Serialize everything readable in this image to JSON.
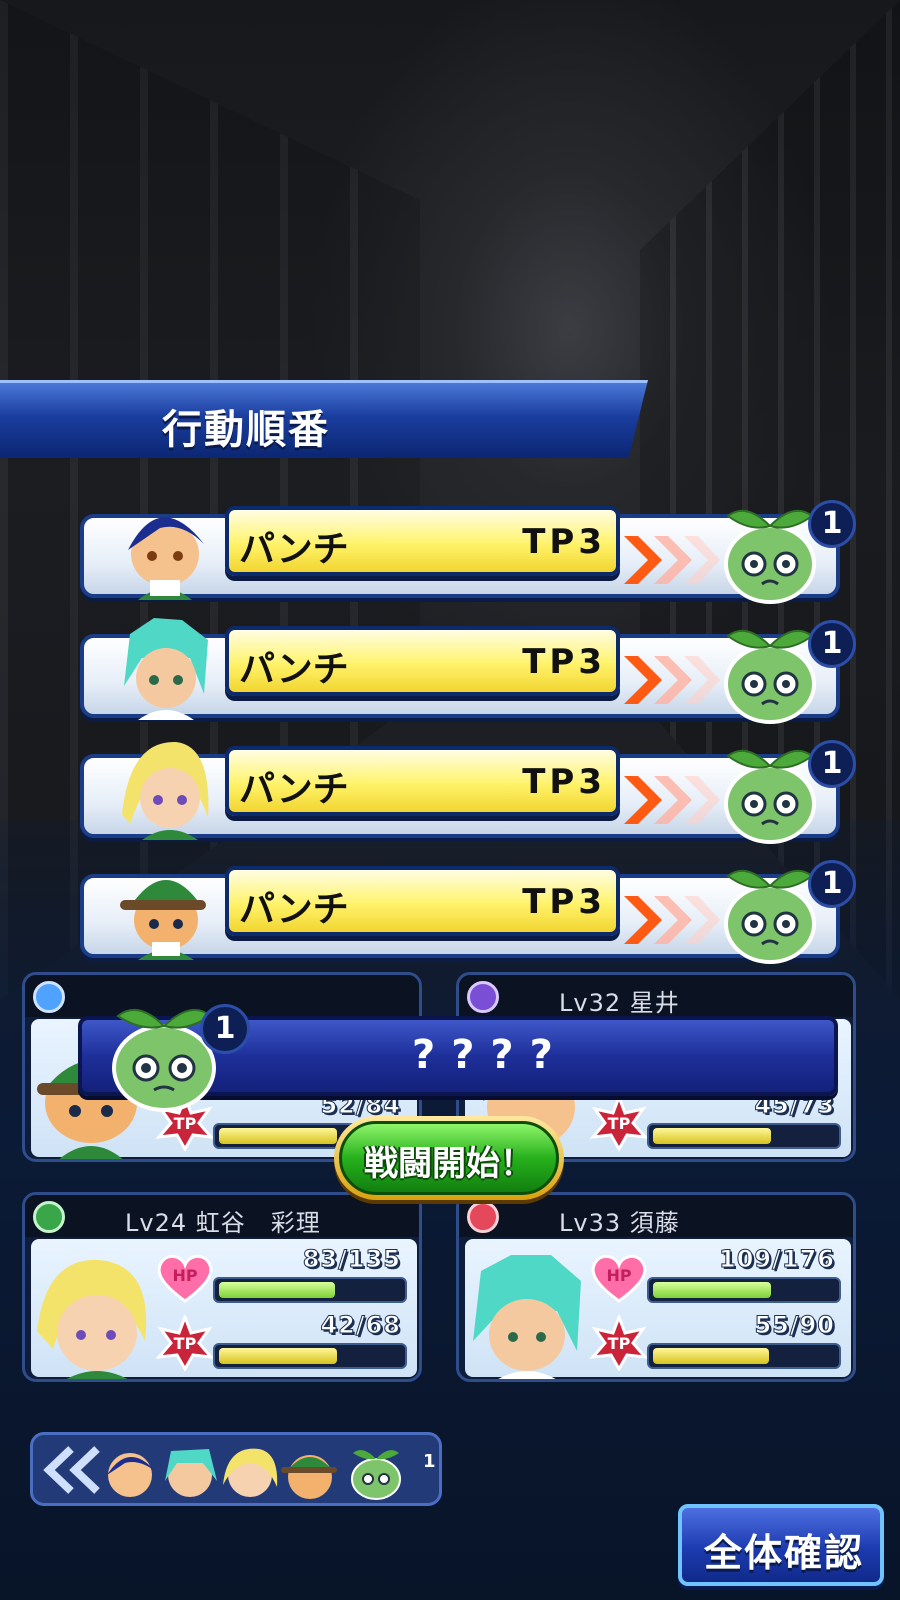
{
  "title": "行動順番",
  "actions": [
    {
      "skill": "パンチ",
      "tp": "TP3",
      "character": "blue-hair-boy",
      "target_number": "1"
    },
    {
      "skill": "パンチ",
      "tp": "TP3",
      "character": "teal-hair-boy",
      "target_number": "1"
    },
    {
      "skill": "パンチ",
      "tp": "TP3",
      "character": "blonde-girl",
      "target_number": "1"
    },
    {
      "skill": "パンチ",
      "tp": "TP3",
      "character": "green-cap-boy",
      "target_number": "1"
    }
  ],
  "enemy_action": {
    "skill": "????",
    "target_number": "1"
  },
  "party": [
    {
      "label": "",
      "hp": "",
      "tp": "52/84",
      "hp_fill": 0.6,
      "tp_fill": 0.62,
      "icon_color": "#4fa3ff"
    },
    {
      "label": "Lv32 星井",
      "hp": "",
      "tp": "45/73",
      "hp_fill": 0.6,
      "tp_fill": 0.62,
      "icon_color": "#7a4fd6"
    },
    {
      "label": "Lv24 虹谷　彩理",
      "hp": "83/135",
      "tp": "42/68",
      "hp_fill": 0.61,
      "tp_fill": 0.62,
      "icon_color": "#3aa64a"
    },
    {
      "label": "Lv33 須藤",
      "hp": "109/176",
      "tp": "55/90",
      "hp_fill": 0.62,
      "tp_fill": 0.61,
      "icon_color": "#e5475b"
    }
  ],
  "start_button": "戦闘開始！",
  "confirm_button": "全体確認",
  "turn_order_badge": "1",
  "colors": {
    "skill_yellow": "#fff36a",
    "panel_blue": "#1a3d9e",
    "start_green": "#27b11c"
  }
}
